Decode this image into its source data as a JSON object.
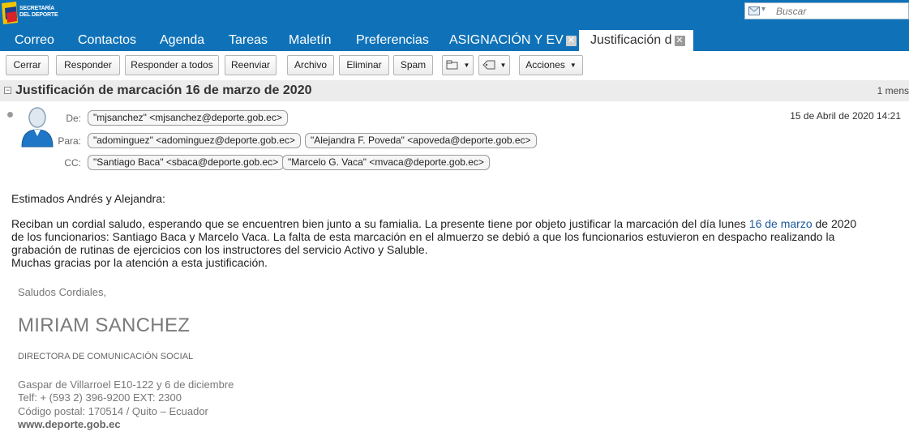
{
  "header": {
    "logo_line1": "SECRETARÍA",
    "logo_line2": "DEL DEPORTE",
    "search_placeholder": "Buscar"
  },
  "tabs": [
    {
      "label": "Correo"
    },
    {
      "label": "Contactos"
    },
    {
      "label": "Agenda"
    },
    {
      "label": "Tareas"
    },
    {
      "label": "Maletín"
    },
    {
      "label": "Preferencias"
    },
    {
      "label": "ASIGNACIÓN Y EV"
    },
    {
      "label": "Justificación d"
    }
  ],
  "toolbar": {
    "close": "Cerrar",
    "reply": "Responder",
    "reply_all": "Responder a todos",
    "forward": "Reenviar",
    "archive": "Archivo",
    "delete": "Eliminar",
    "spam": "Spam",
    "actions": "Acciones"
  },
  "message": {
    "subject": "Justificación de marcación 16 de marzo de 2020",
    "count": "1 mens",
    "date": "15 de Abril de 2020 14:21",
    "labels": {
      "from": "De:",
      "to": "Para:",
      "cc": "CC:"
    },
    "from": "\"mjsanchez\" <mjsanchez@deporte.gob.ec>",
    "to": [
      "\"adominguez\" <adominguez@deporte.gob.ec>",
      "\"Alejandra F. Poveda\" <apoveda@deporte.gob.ec>"
    ],
    "cc": [
      "\"Santiago Baca\" <sbaca@deporte.gob.ec>",
      "\"Marcelo G. Vaca\" <mvaca@deporte.gob.ec>"
    ]
  },
  "body": {
    "greeting": "Estimados Andrés y Alejandra:",
    "p1_before": "Reciban un cordial saludo, esperando que se encuentren bien junto a su famialia. La presente tiene por objeto justificar la marcación del día lunes ",
    "p1_link": "16 de marzo",
    "p1_after": " de 2020",
    "p1_line2": "de los funcionarios: Santiago Baca y Marcelo Vaca. La falta de esta marcación en el almuerzo se debió a que los funcionarios estuvieron en despacho realizando la",
    "p1_line3": "grabación de rutinas de ejercicios con los instructores del servicio Activo y Saluble.",
    "p1_line4": "Muchas gracias por la atención a esta justificación."
  },
  "signature": {
    "closing": "Saludos Cordiales,",
    "name": "MIRIAM SANCHEZ",
    "title": "DIRECTORA DE COMUNICACIÓN SOCIAL",
    "address": "Gaspar de Villarroel E10-122 y 6 de diciembre",
    "phone": "Telf: + (593 2) 396-9200 EXT: 2300",
    "postal": "Código postal: 170514 / Quito – Ecuador",
    "website": "www.deporte.gob.ec"
  },
  "colors": {
    "brand_blue": "#0f72b8",
    "link": "#1a5a9a"
  }
}
